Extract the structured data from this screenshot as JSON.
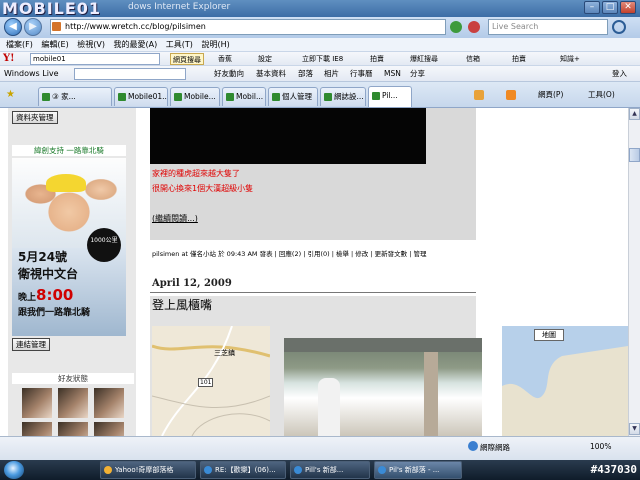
{
  "window": {
    "brand": "MOBILE01",
    "title": "dows Internet Explorer",
    "min_glyph": "–",
    "max_glyph": "□",
    "close_glyph": "✕"
  },
  "address_bar": {
    "back_glyph": "◀",
    "forward_glyph": "▶",
    "url": "http://www.wretch.cc/blog/pilsimen",
    "search_placeholder": "Live Search"
  },
  "menu": [
    "檔案(F)",
    "編輯(E)",
    "檢視(V)",
    "我的最愛(A)",
    "工具(T)",
    "說明(H)"
  ],
  "yahoo_toolbar": {
    "logo": "Y!",
    "query": "mobile01",
    "buttons": [
      "網頁搜尋",
      "香蕉",
      "設定",
      "立即下載 IE8",
      "拍賣",
      "爆紅搜尋",
      "信箱",
      "拍賣",
      "知識+"
    ]
  },
  "wl_toolbar": {
    "logo": "Windows Live",
    "items": [
      "好友動向",
      "基本資料",
      "部落",
      "相片",
      "行事曆",
      "MSN",
      "分享",
      "登入"
    ]
  },
  "tabs": {
    "items": [
      "③ 家...",
      "Mobile01...",
      "Mobile...",
      "Mobil...",
      "個人管理",
      "網誌設...",
      "Pil..."
    ],
    "commands": [
      "網頁(P)",
      "工具(O)"
    ]
  },
  "sidebar": {
    "manage_button": "資料夾管理",
    "ad_heading": "緯創支持 一路靠北騎",
    "ad_badge": "1000公里",
    "ad_date": "5月24號",
    "ad_channel": "衛視中文台",
    "ad_time_prefix": "晚上",
    "ad_time": "8:00",
    "ad_subtitle": "跟我們一路靠北騎",
    "link_button": "連結管理",
    "friends_title": "好友狀態"
  },
  "post": {
    "red_line1": "家裡的種虎超來越大隻了",
    "red_line2": "很開心換來1個大漢超級小隻",
    "read_more": "(繼續閱讀...)",
    "meta": "pilsimen at 僅名小站 於 09:43 AM 發表 | 回應(2) | 引用(0) | 檢舉 | 修改 | 更新發文數 | 管理",
    "date": "April 12, 2009",
    "title": "登上風櫃嘴",
    "map_labels": [
      "三芝鎮",
      "101"
    ],
    "right_map_label": "地圖"
  },
  "statusbar": {
    "network": "網際網路",
    "zoom": "100%"
  },
  "taskbar": {
    "items": [
      "Yahoo!奇摩部落格",
      "RE:【歡樂】(06)...",
      "Pill's 新部...",
      "Pil's 新部落 - ..."
    ],
    "clock": "#437030"
  }
}
